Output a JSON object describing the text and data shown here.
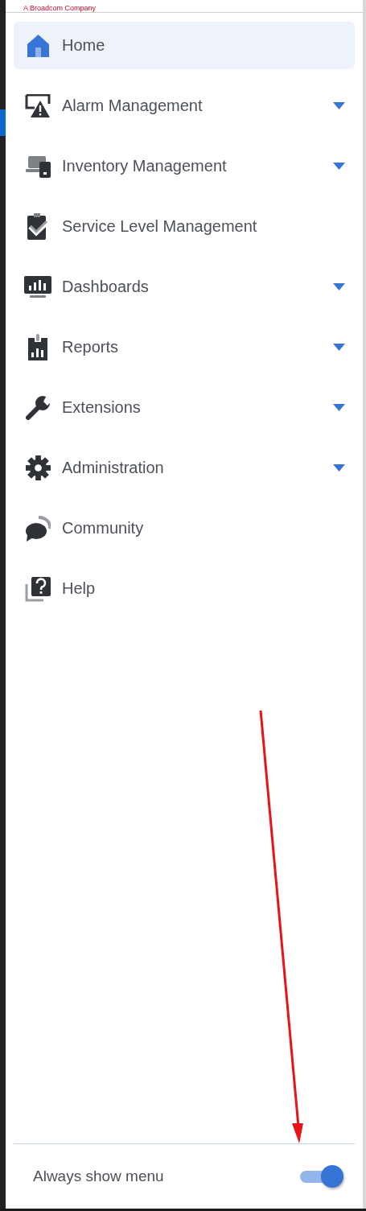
{
  "brand": {
    "tagline": "A Broadcom Company"
  },
  "menu": [
    {
      "label": "Home",
      "expandable": false,
      "selected": true
    },
    {
      "label": "Alarm Management",
      "expandable": true,
      "selected": false
    },
    {
      "label": "Inventory Management",
      "expandable": true,
      "selected": false
    },
    {
      "label": "Service Level Management",
      "expandable": false,
      "selected": false
    },
    {
      "label": "Dashboards",
      "expandable": true,
      "selected": false
    },
    {
      "label": "Reports",
      "expandable": true,
      "selected": false
    },
    {
      "label": "Extensions",
      "expandable": true,
      "selected": false
    },
    {
      "label": "Administration",
      "expandable": true,
      "selected": false
    },
    {
      "label": "Community",
      "expandable": false,
      "selected": false
    },
    {
      "label": "Help",
      "expandable": false,
      "selected": false
    }
  ],
  "footer": {
    "label": "Always show menu",
    "on": true
  }
}
